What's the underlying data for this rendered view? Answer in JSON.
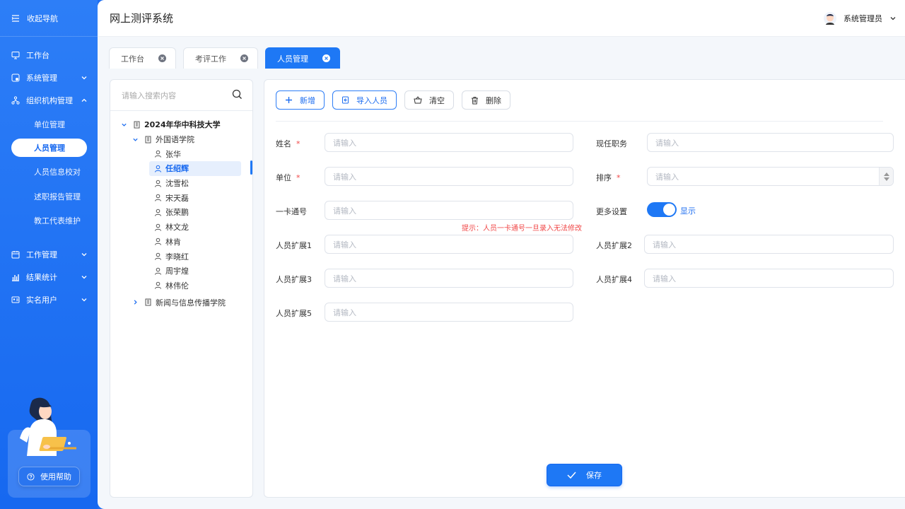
{
  "sidebar": {
    "collapse_label": "收起导航",
    "items": [
      {
        "label": "工作台"
      },
      {
        "label": "系统管理"
      },
      {
        "label": "组织机构管理"
      }
    ],
    "sub_items": [
      {
        "label": "单位管理"
      },
      {
        "label": "人员管理"
      },
      {
        "label": "人员信息校对"
      },
      {
        "label": "述职报告管理"
      },
      {
        "label": "教工代表维护"
      }
    ],
    "items2": [
      {
        "label": "工作管理"
      },
      {
        "label": "结果统计"
      },
      {
        "label": "实名用户"
      }
    ],
    "help_label": "使用帮助"
  },
  "header": {
    "title": "网上测评系统",
    "user_name": "系统管理员"
  },
  "tabs": [
    {
      "label": "工作台"
    },
    {
      "label": "考评工作"
    },
    {
      "label": "人员管理"
    }
  ],
  "tree": {
    "search_placeholder": "请输入搜索内容",
    "root": "2024年华中科技大学",
    "college1": "外国语学院",
    "people": [
      "张华",
      "任绍辉",
      "沈雪松",
      "宋天磊",
      "张荣鹏",
      "林文龙",
      "林肯",
      "李晓红",
      "周宇煌",
      "林伟伦"
    ],
    "college2": "新闻与信息传播学院"
  },
  "toolbar": {
    "add": "新增",
    "import": "导入人员",
    "clear": "清空",
    "delete": "删除"
  },
  "form": {
    "placeholder": "请输入",
    "name_label": "姓名",
    "position_label": "现任职务",
    "unit_label": "单位",
    "order_label": "排序",
    "card_label": "一卡通号",
    "more_label": "更多设置",
    "toggle_label": "显示",
    "hint": "提示：人员一卡通号一旦录入无法修改",
    "ext1": "人员扩展1",
    "ext2": "人员扩展2",
    "ext3": "人员扩展3",
    "ext4": "人员扩展4",
    "ext5": "人员扩展5",
    "required_mark": "*"
  },
  "save_label": "保存",
  "colors": {
    "accent": "#1e78f5",
    "sidebar": "#1668f0",
    "required": "#f04848"
  }
}
